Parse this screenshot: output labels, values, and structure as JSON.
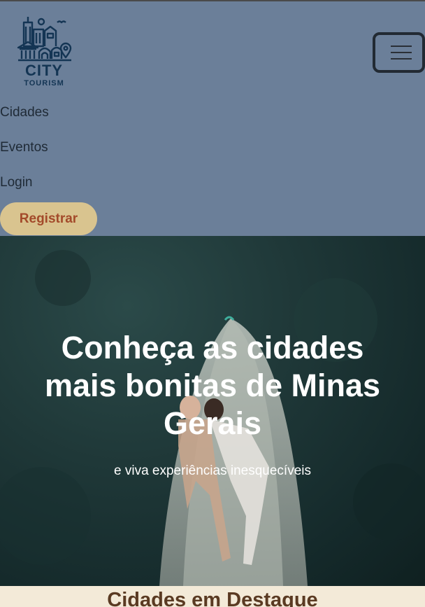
{
  "brand": {
    "logo_line1": "CITY",
    "logo_line2": "TOURISM",
    "logo_color": "#143554"
  },
  "nav": {
    "items": [
      {
        "label": "Cidades"
      },
      {
        "label": "Eventos"
      },
      {
        "label": "Login"
      }
    ],
    "register_label": "Registrar",
    "menu_icon": "hamburger-icon"
  },
  "hero": {
    "title": "Conheça as cidades mais bonitas de Minas Gerais",
    "subtitle": "e viva experiências inesquecíveis"
  },
  "featured": {
    "title": "Cidades em Destaque"
  },
  "colors": {
    "navbar_bg": "#6b7f99",
    "register_bg": "#d9c48f",
    "register_text": "#a34a2a",
    "page_bg": "#f3ead8",
    "hero_overlay": "#1f3838"
  }
}
